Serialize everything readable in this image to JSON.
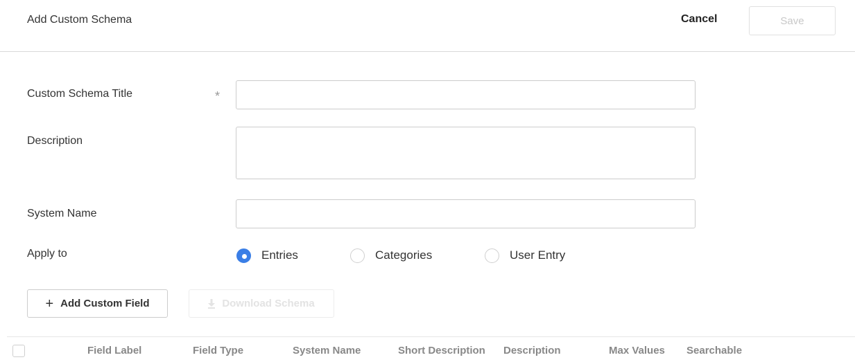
{
  "header": {
    "title": "Add Custom Schema",
    "cancel_label": "Cancel",
    "save_label": "Save"
  },
  "form": {
    "title_label": "Custom Schema Title",
    "required_mark": "*",
    "title_value": "",
    "description_label": "Description",
    "description_value": "",
    "system_name_label": "System Name",
    "system_name_value": "",
    "apply_to_label": "Apply to",
    "apply_to_options": [
      {
        "label": "Entries",
        "selected": true
      },
      {
        "label": "Categories",
        "selected": false
      },
      {
        "label": "User Entry",
        "selected": false
      }
    ]
  },
  "actions": {
    "add_field_icon": "plus-icon",
    "add_field_label": "Add Custom Field",
    "download_icon": "download-icon",
    "download_label": "Download Schema"
  },
  "table": {
    "columns": [
      "Field Label",
      "Field Type",
      "System Name",
      "Short Description",
      "Description",
      "Max Values",
      "Searchable"
    ]
  },
  "colors": {
    "accent": "#3a7ee6",
    "border": "#cccccc",
    "disabled_text": "#c8c8c8"
  }
}
